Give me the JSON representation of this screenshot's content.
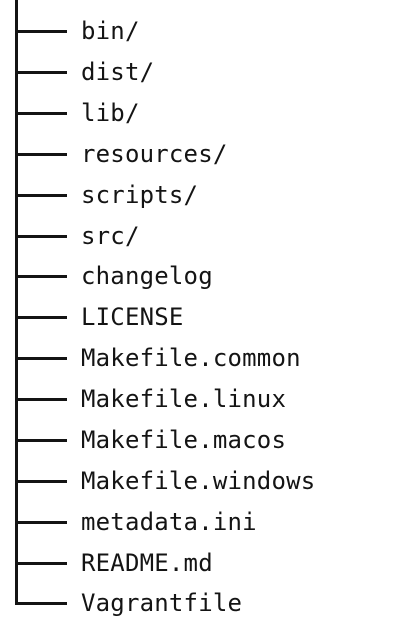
{
  "tree": {
    "entries": [
      {
        "label": "bin/"
      },
      {
        "label": "dist/"
      },
      {
        "label": "lib/"
      },
      {
        "label": "resources/"
      },
      {
        "label": "scripts/"
      },
      {
        "label": "src/"
      },
      {
        "label": "changelog"
      },
      {
        "label": "LICENSE"
      },
      {
        "label": "Makefile.common"
      },
      {
        "label": "Makefile.linux"
      },
      {
        "label": "Makefile.macos"
      },
      {
        "label": "Makefile.windows"
      },
      {
        "label": "metadata.ini"
      },
      {
        "label": "README.md"
      },
      {
        "label": "Vagrantfile"
      }
    ]
  }
}
